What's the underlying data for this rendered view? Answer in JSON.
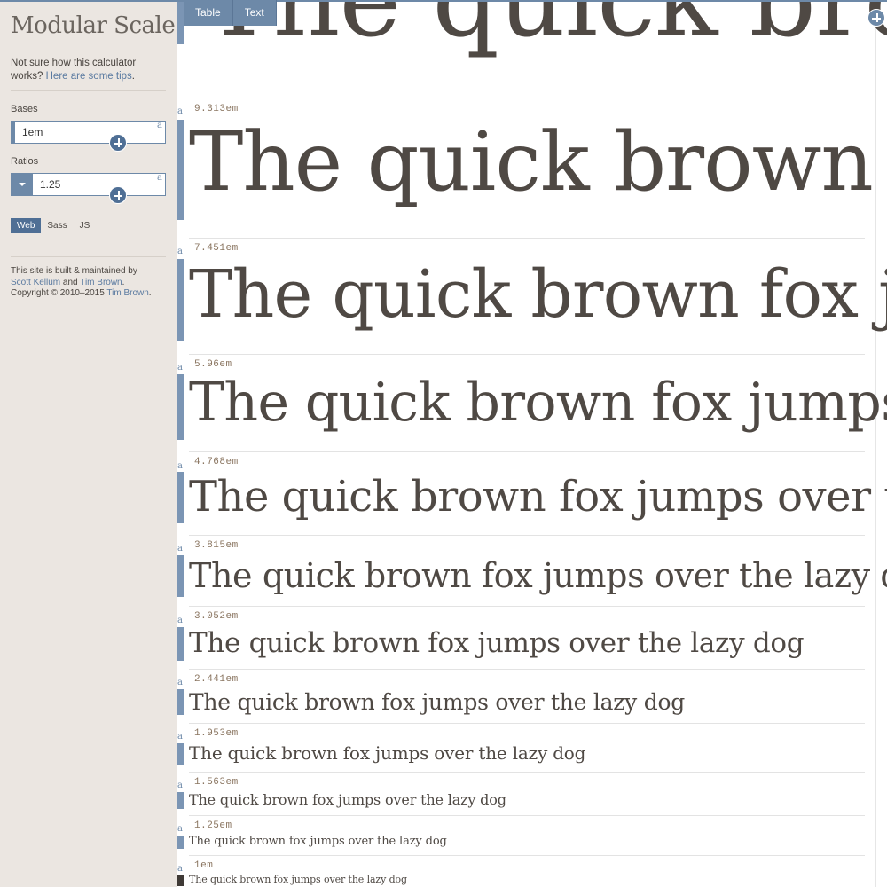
{
  "sidebar": {
    "title": "Modular Scale",
    "intro_text": "Not sure how this calculator works? ",
    "intro_link": "Here are some tips",
    "intro_end": ".",
    "bases_label": "Bases",
    "bases_value": "1em",
    "ratios_label": "Ratios",
    "ratios_value": "1.25",
    "field_glyph": "a",
    "output_tabs": [
      "Web",
      "Sass",
      "JS"
    ],
    "footer_line1": "This site is built & maintained by",
    "footer_name1": "Scott Kellum",
    "footer_and": " and ",
    "footer_name2": "Tim Brown",
    "footer_period": ".",
    "footer_copy": "Copyright © 2010–2015 ",
    "footer_name3": "Tim Brown",
    "footer_period2": "."
  },
  "top_tabs": [
    "Table",
    "Text"
  ],
  "scale": {
    "glyph": "a",
    "sample_text": "The quick brown fox jumps over the lazy dog",
    "steps": [
      {
        "em": ""
      },
      {
        "em": "9.313em"
      },
      {
        "em": "7.451em"
      },
      {
        "em": "5.96em"
      },
      {
        "em": "4.768em"
      },
      {
        "em": "3.815em"
      },
      {
        "em": "3.052em"
      },
      {
        "em": "2.441em"
      },
      {
        "em": "1.953em"
      },
      {
        "em": "1.563em"
      },
      {
        "em": "1.25em"
      },
      {
        "em": "1em"
      }
    ]
  },
  "colors": {
    "accent": "#6d89a8",
    "accent_dark": "#4f6f95",
    "text": "#4f4944",
    "sidebar_bg": "#ebe6e1"
  }
}
